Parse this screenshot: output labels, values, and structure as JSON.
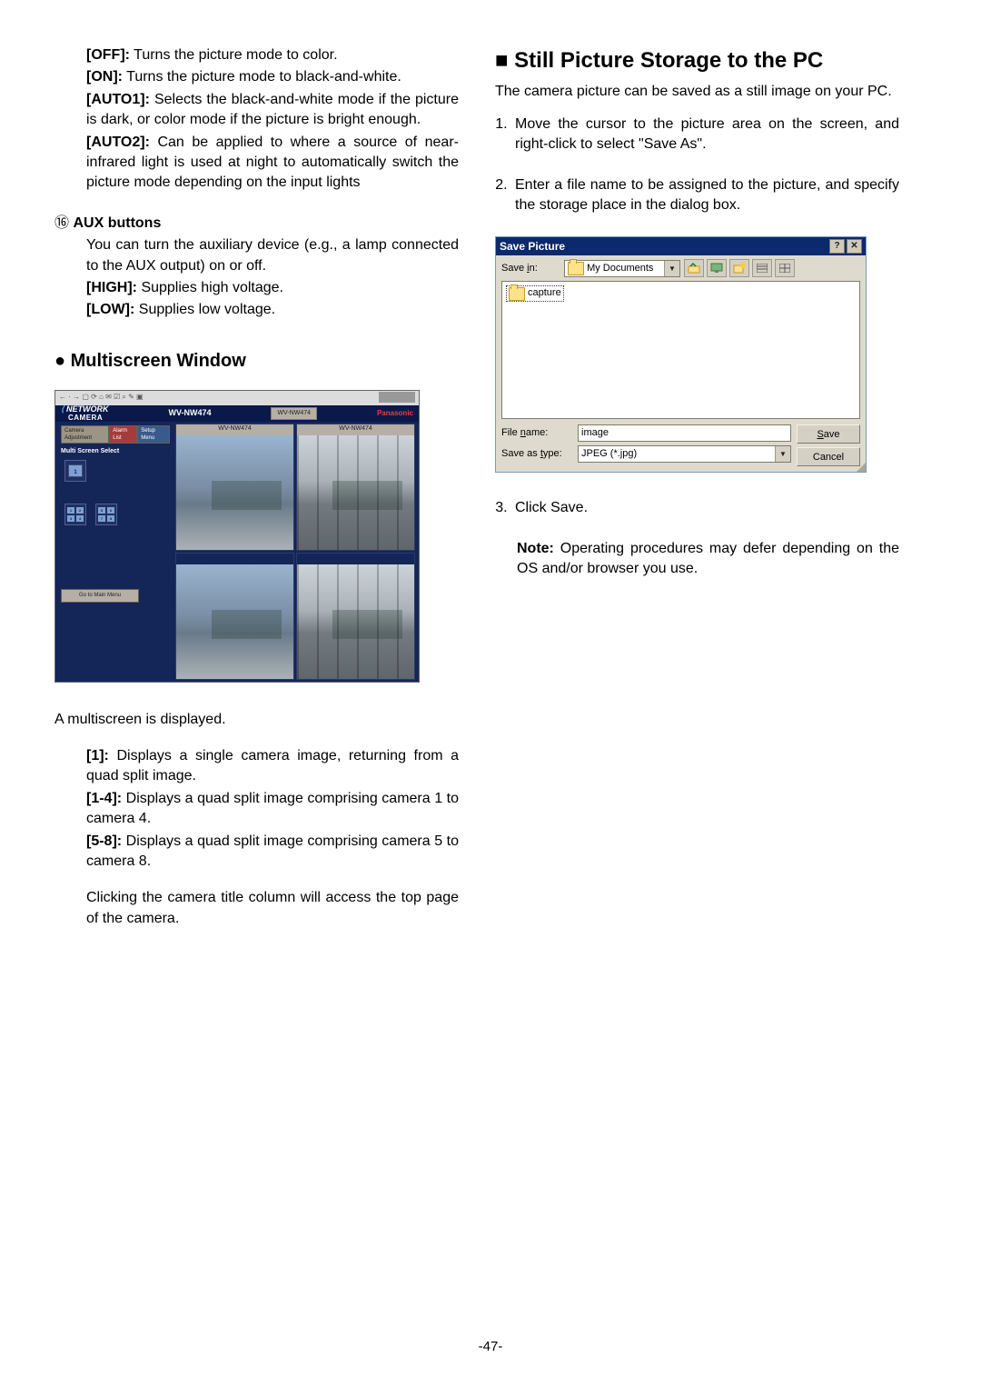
{
  "left": {
    "modes": {
      "off": {
        "label": "[OFF]:",
        "text": "Turns the picture mode to color."
      },
      "on": {
        "label": "[ON]:",
        "text": "Turns the picture mode to black-and-white."
      },
      "auto1": {
        "label": "[AUTO1]:",
        "text": "Selects the black-and-white mode if the picture is dark, or color mode if the picture is bright enough."
      },
      "auto2": {
        "label": "[AUTO2]:",
        "text": "Can be applied to where a source of near-infrared light is used at night to automatically switch the picture mode depending on the input lights"
      }
    },
    "aux": {
      "num": "⑯",
      "title": "AUX buttons",
      "text": "You can turn the auxiliary device (e.g., a lamp connected to the AUX output) on or off.",
      "high": {
        "label": "[HIGH]:",
        "text": "Supplies high voltage."
      },
      "low": {
        "label": "[LOW]:",
        "text": "Supplies low voltage."
      }
    },
    "multiscreen": {
      "heading": "● Multiscreen Window",
      "shot": {
        "toolbar_icons": "← · → ▢ ⟳ ⌂ ✉ ☑ ⌕ ✎ ▣",
        "logo_top": "NETWORK",
        "logo_sub": "CAMERA",
        "model": "WV-NW474",
        "top_btn": "WV-NW474",
        "brand": "Panasonic",
        "tab1": "Camera Adjustment",
        "tab2": "Alarm List",
        "tab3": "Setup Menu",
        "panel_label": "Multi Screen Select",
        "single_label": "1",
        "quad1_label": "1-4",
        "quad2_label": "5-8",
        "gomain": "Go to Main Menu",
        "cam_title": "WV-NW474"
      },
      "caption": "A multiscreen is displayed.",
      "items": {
        "i1": {
          "label": "[1]:",
          "text": "Displays a single camera image, returning from a quad split image."
        },
        "i14": {
          "label": "[1-4]:",
          "text": "Displays a quad split image comprising camera 1 to camera 4."
        },
        "i58": {
          "label": "[5-8]:",
          "text": "Displays a quad split image comprising camera 5 to camera 8."
        }
      },
      "foot": "Clicking the camera title column will access the top page of the camera."
    }
  },
  "right": {
    "heading": "■ Still Picture Storage to the PC",
    "intro": "The camera picture can be saved as a still image on your PC.",
    "steps": {
      "s1": "Move the cursor to the picture area on the screen, and right-click to select \"Save As\".",
      "s2": "Enter a file name to be assigned to the picture, and specify the storage place in the dialog box.",
      "s3": "Click Save."
    },
    "savebox": {
      "title": "Save Picture",
      "help": "?",
      "close": "✕",
      "savein_label": "Save in:",
      "savein_u": "i",
      "folder": "My Documents",
      "list_item": "capture",
      "filename_label": "File name:",
      "filename_u": "n",
      "filename_value": "image",
      "savetype_label": "Save as type:",
      "savetype_u": "t",
      "savetype_value": "JPEG (*.jpg)",
      "save_btn": "Save",
      "save_u": "S",
      "cancel_btn": "Cancel"
    },
    "note_label": "Note:",
    "note_text": "Operating procedures may defer depending on the OS and/or browser you use."
  },
  "pagenum": "-47-"
}
